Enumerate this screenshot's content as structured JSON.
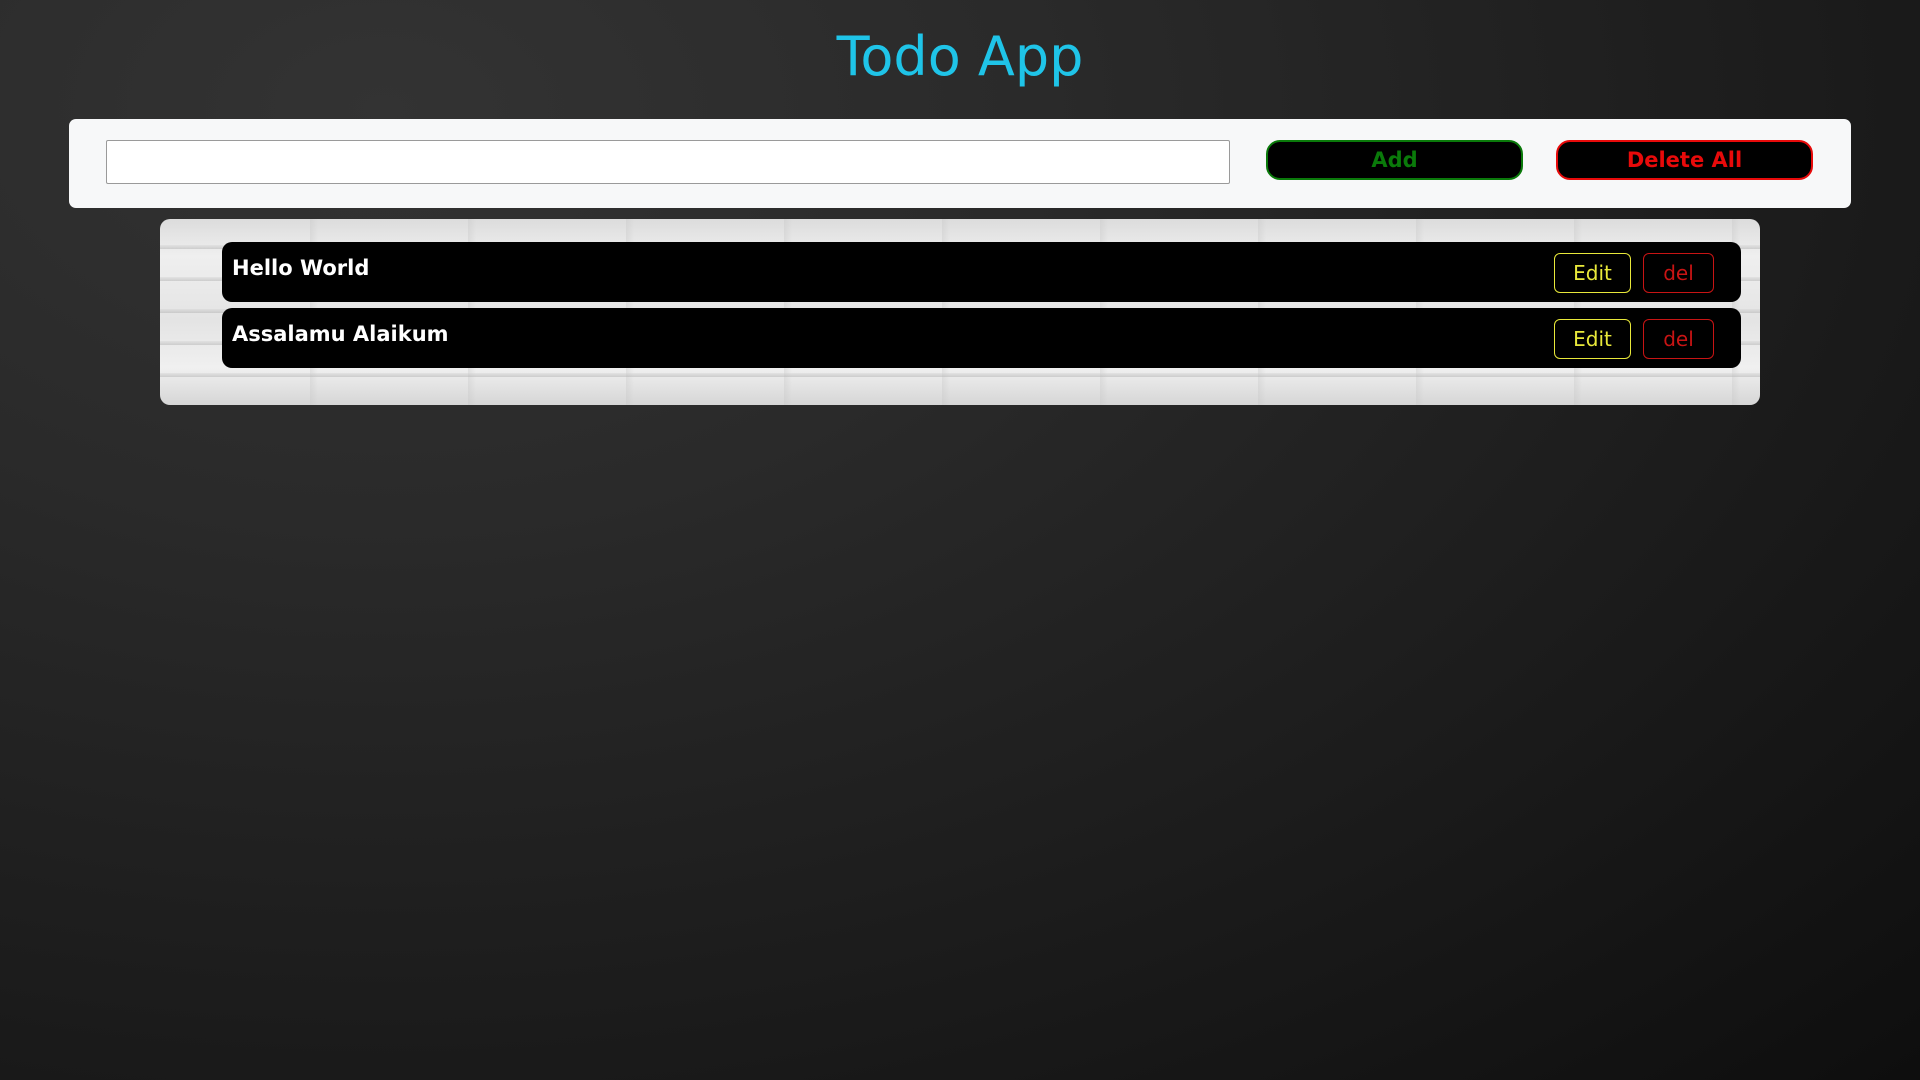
{
  "app": {
    "title": "Todo App"
  },
  "input_bar": {
    "todo_input_value": "",
    "todo_input_placeholder": "",
    "add_label": "Add",
    "delete_all_label": "Delete All"
  },
  "todos": [
    {
      "text": "Hello World",
      "edit_label": "Edit",
      "del_label": "del"
    },
    {
      "text": "Assalamu Alaikum",
      "edit_label": "Edit",
      "del_label": "del"
    }
  ],
  "colors": {
    "title": "#1fc4e8",
    "add_accent": "#0a7a0a",
    "delete_all_accent": "#e80a0a",
    "edit_accent": "#e8e83a",
    "del_accent": "#c81414"
  }
}
